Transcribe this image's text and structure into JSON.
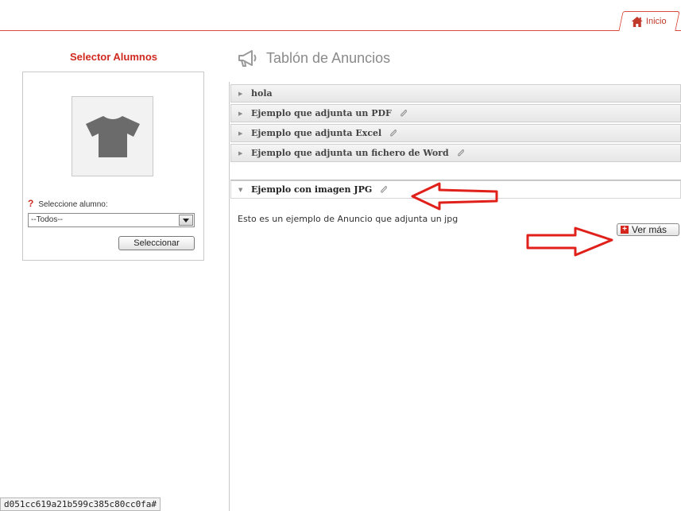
{
  "header": {
    "home_tab_label": "Inicio"
  },
  "selector": {
    "title": "Selector Alumnos",
    "help_mark": "?",
    "label": "Seleccione alumno:",
    "selected_value": "--Todos--",
    "button_label": "Seleccionar"
  },
  "board": {
    "title": "Tablón de Anuncios",
    "items": [
      {
        "label": "hola",
        "attachment": false
      },
      {
        "label": "Ejemplo que adjunta un PDF",
        "attachment": true
      },
      {
        "label": "Ejemplo que adjunta Excel",
        "attachment": true
      },
      {
        "label": "Ejemplo que adjunta un fichero de Word",
        "attachment": true
      },
      {
        "label": "Ejemplo con imagen JPG",
        "attachment": true,
        "expanded": true
      }
    ],
    "open_content": "Esto es un ejemplo de Anuncio que adjunta un jpg",
    "more_button_label": "Ver más"
  },
  "status_bar": {
    "url_fragment": "d051cc619a21b599c385c80cc0fa#"
  },
  "colors": {
    "accent": "#cf2a1f",
    "annotation_arrow": "#e0201a"
  },
  "icons": [
    "home-icon",
    "megaphone-icon",
    "tshirt-icon",
    "paperclip-icon",
    "chevron-down-icon",
    "plus-icon",
    "annotation-arrow"
  ]
}
